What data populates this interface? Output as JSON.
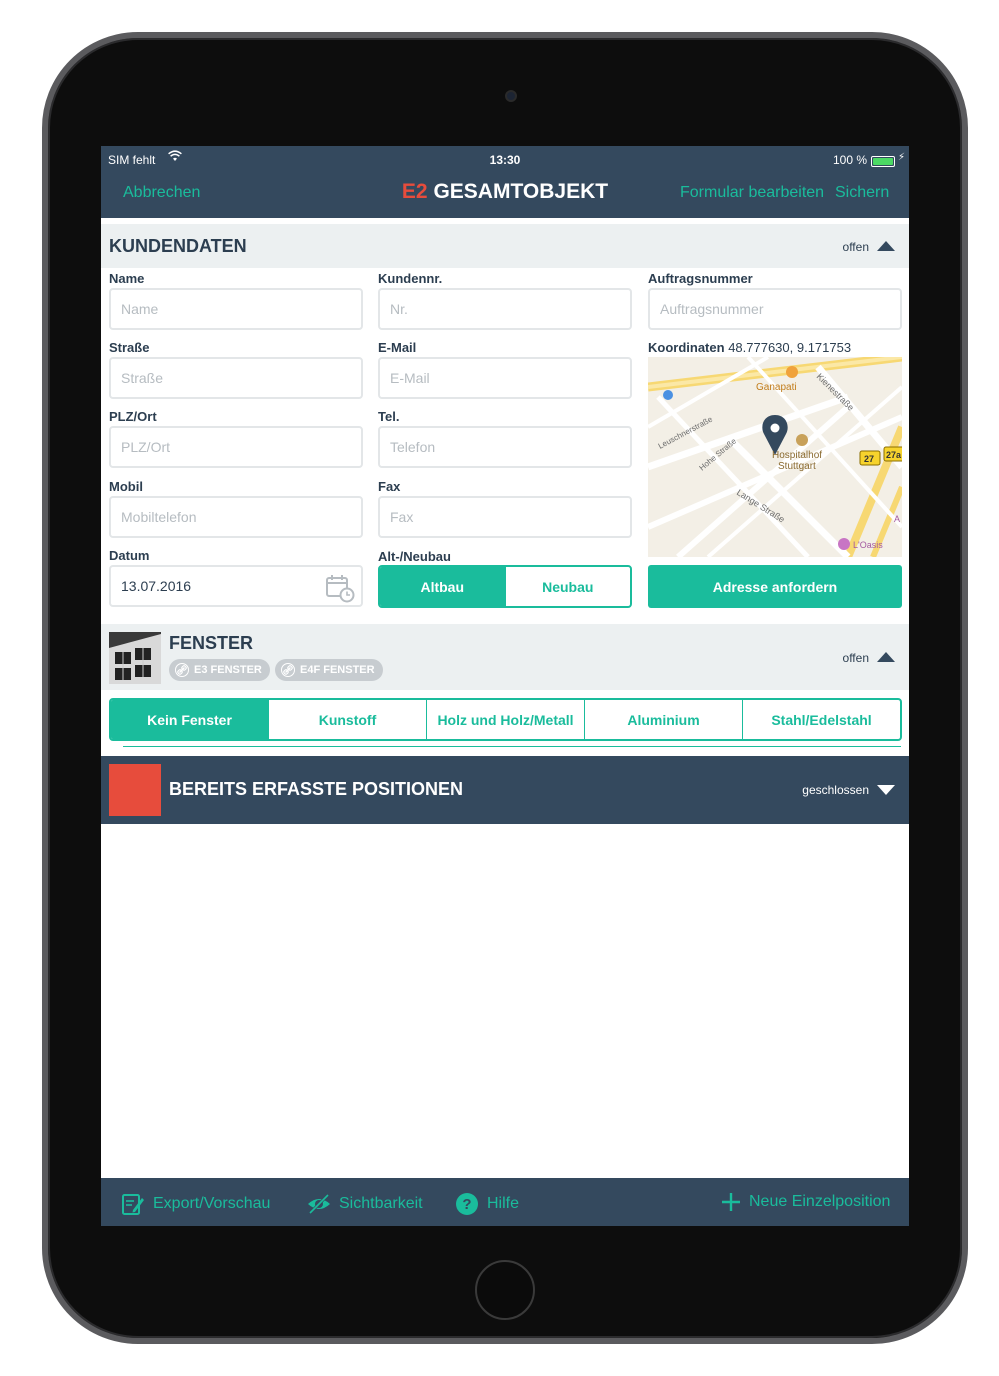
{
  "status": {
    "carrier": "SIM fehlt",
    "time": "13:30",
    "battery": "100 %"
  },
  "nav": {
    "cancel": "Abbrechen",
    "title_code": "E2",
    "title_text": "GESAMTOBJEKT",
    "edit": "Formular bearbeiten",
    "save": "Sichern"
  },
  "customer": {
    "title": "KUNDENDATEN",
    "state": "offen",
    "fields": {
      "name": {
        "label": "Name",
        "placeholder": "Name"
      },
      "customer_no": {
        "label": "Kundennr.",
        "placeholder": "Nr."
      },
      "order_no": {
        "label": "Auftragsnummer",
        "placeholder": "Auftragsnummer"
      },
      "street": {
        "label": "Straße",
        "placeholder": "Straße"
      },
      "email": {
        "label": "E-Mail",
        "placeholder": "E-Mail"
      },
      "zip_city": {
        "label": "PLZ/Ort",
        "placeholder": "PLZ/Ort"
      },
      "phone": {
        "label": "Tel.",
        "placeholder": "Telefon"
      },
      "mobile": {
        "label": "Mobil",
        "placeholder": "Mobiltelefon"
      },
      "fax": {
        "label": "Fax",
        "placeholder": "Fax"
      },
      "date": {
        "label": "Datum",
        "value": "13.07.2016"
      }
    },
    "coordinates_label": "Koordinaten",
    "coordinates_value": "48.777630, 9.171753",
    "build_type": {
      "label": "Alt-/Neubau",
      "options": [
        "Altbau",
        "Neubau"
      ],
      "selected": "Altbau"
    },
    "request_address": "Adresse anfordern",
    "map": {
      "labels": [
        "Ganapati",
        "Kienestraße",
        "Leuschnerstraße",
        "Hohe Straße",
        "Hospitalhof",
        "Stuttgart",
        "Lange Straße",
        "L'Oasis",
        "27a",
        "27",
        "A"
      ]
    }
  },
  "windows": {
    "title": "FENSTER",
    "state": "offen",
    "tags": [
      "E3 FENSTER",
      "E4F FENSTER"
    ],
    "options": [
      "Kein Fenster",
      "Kunstoff",
      "Holz und Holz/Metall",
      "Aluminium",
      "Stahl/Edelstahl"
    ],
    "selected": "Kein Fenster"
  },
  "positions": {
    "title": "BEREITS ERFASSTE POSITIONEN",
    "state": "geschlossen"
  },
  "toolbar": {
    "export": "Export/Vorschau",
    "visibility": "Sichtbarkeit",
    "help": "Hilfe",
    "new_position": "Neue Einzelposition"
  },
  "colors": {
    "accent": "#1abc9c",
    "navy": "#34495e",
    "red": "#e74c3c",
    "light": "#ecf0f1"
  }
}
